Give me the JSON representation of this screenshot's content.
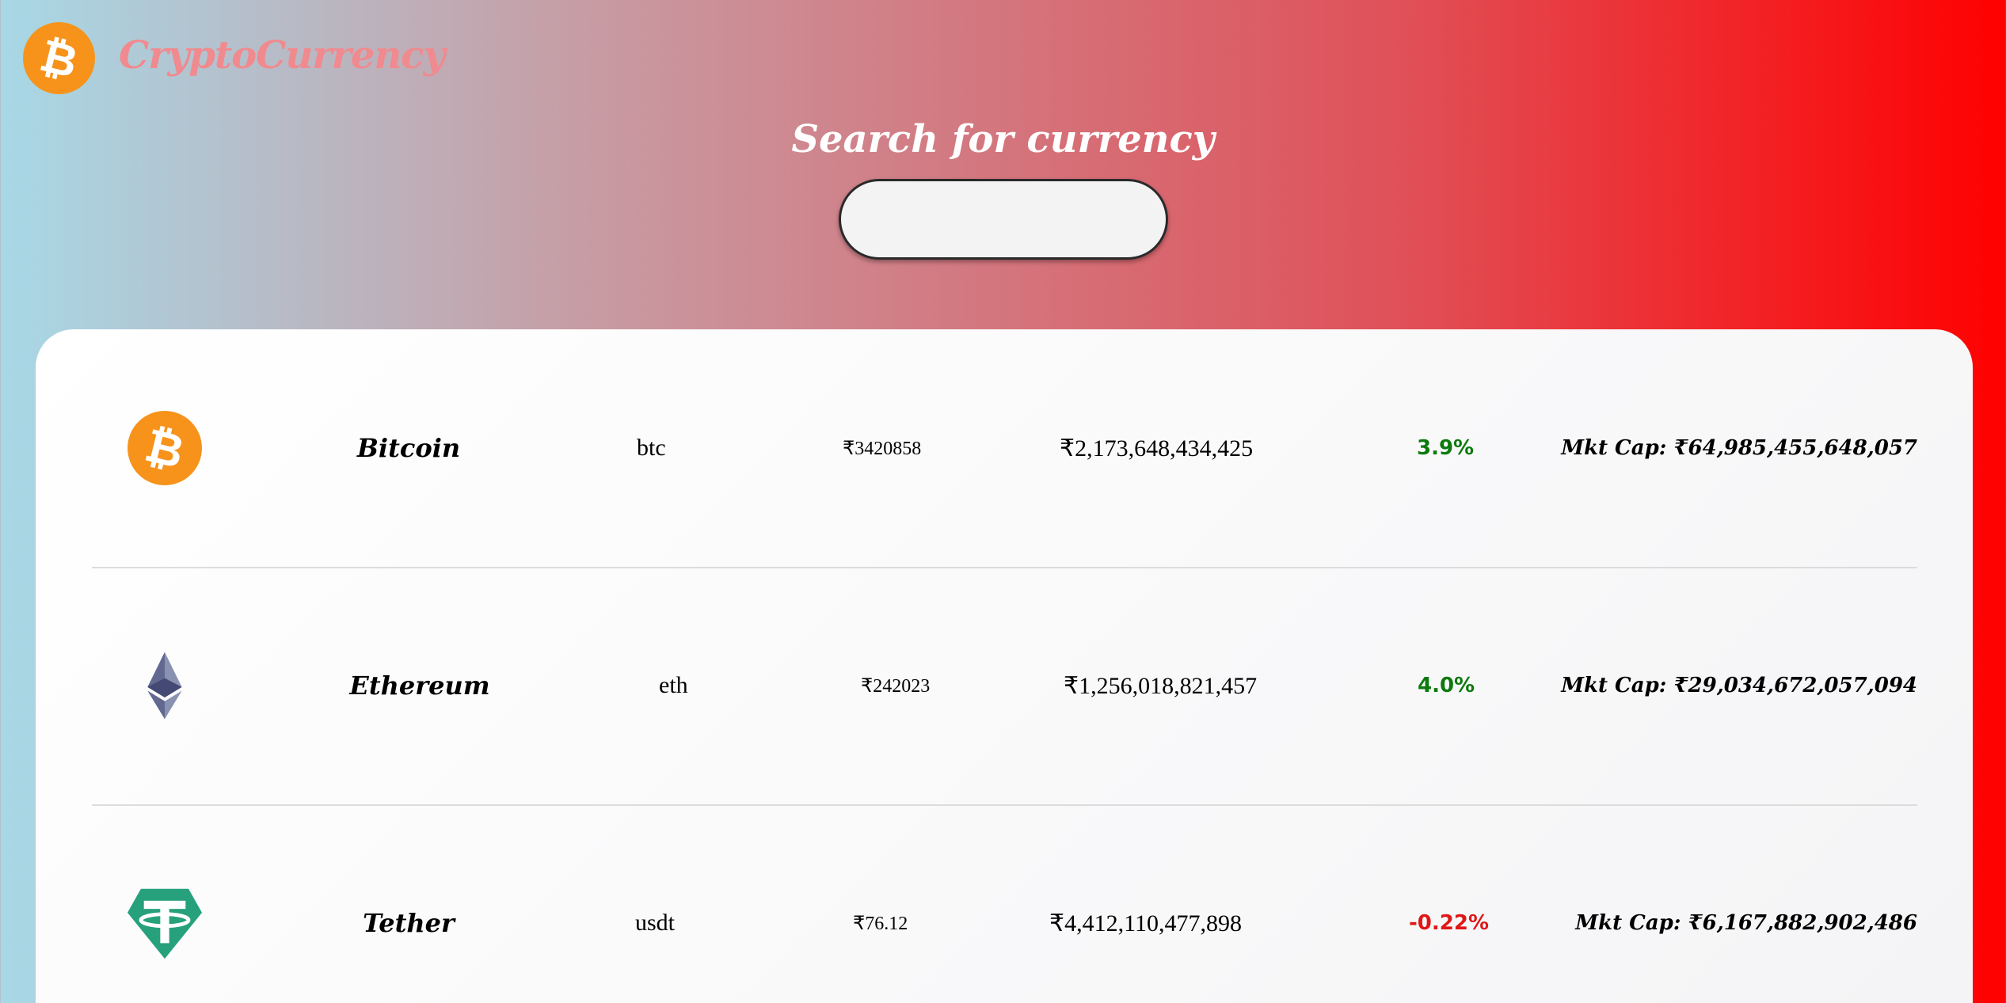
{
  "header": {
    "brand": "CryptoCurrency",
    "logo_icon": "bitcoin-logo-icon"
  },
  "search": {
    "title": "Search for currency",
    "value": "",
    "placeholder": ""
  },
  "coins": [
    {
      "icon": "bitcoin-icon",
      "name": "Bitcoin",
      "symbol": "btc",
      "price": "₹3420858",
      "volume": "₹2,173,648,434,425",
      "change": "3.9%",
      "change_direction": "up",
      "market_cap": "Mkt Cap: ₹64,985,455,648,057"
    },
    {
      "icon": "ethereum-icon",
      "name": "Ethereum",
      "symbol": "eth",
      "price": "₹242023",
      "volume": "₹1,256,018,821,457",
      "change": "4.0%",
      "change_direction": "up",
      "market_cap": "Mkt Cap: ₹29,034,672,057,094"
    },
    {
      "icon": "tether-icon",
      "name": "Tether",
      "symbol": "usdt",
      "price": "₹76.12",
      "volume": "₹4,412,110,477,898",
      "change": "-0.22%",
      "change_direction": "down",
      "market_cap": "Mkt Cap: ₹6,167,882,902,486"
    }
  ],
  "colors": {
    "positive": "#0c7a0c",
    "negative": "#e01616",
    "bitcoin_orange": "#f7931a",
    "tether_green": "#26a17b",
    "brand_pink": "#f08a8e"
  }
}
